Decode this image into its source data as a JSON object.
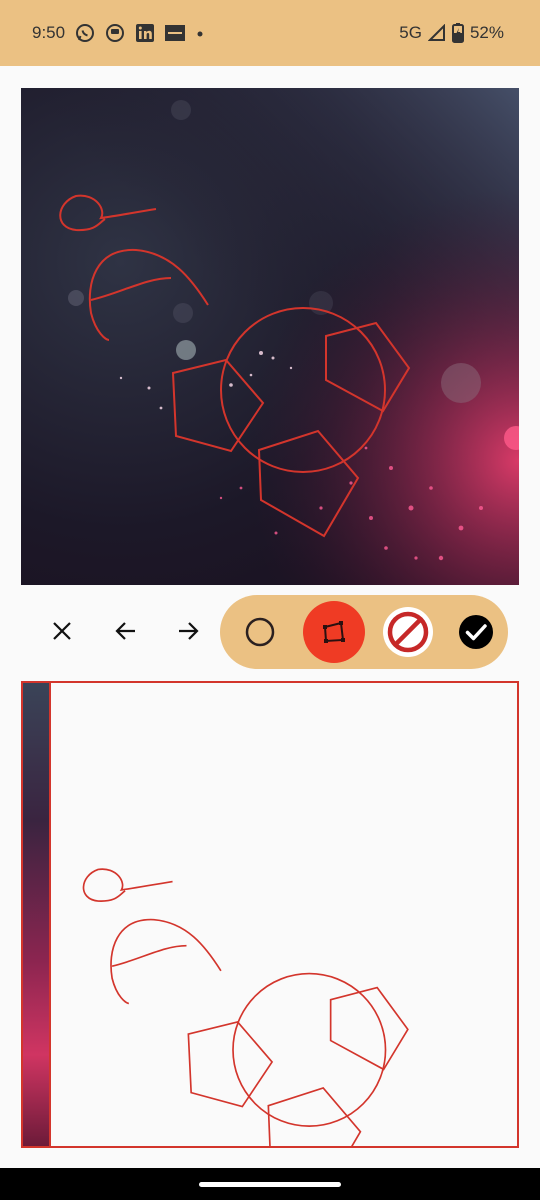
{
  "status_bar": {
    "time": "9:50",
    "network": "5G",
    "battery": "52%",
    "notification_icons": [
      "whatsapp-icon",
      "app-icon",
      "linkedin-icon",
      "news-app-icon",
      "more-dot-icon"
    ],
    "background": "#ebc183"
  },
  "editor": {
    "photo_description_colors": {
      "dark": "#1a1527",
      "accent": "#e03a6a"
    },
    "stroke_color": "#d3352c"
  },
  "toolbar": {
    "close_icon": "close-icon",
    "undo_icon": "arrow-left-icon",
    "redo_icon": "arrow-right-icon",
    "tools": [
      {
        "name": "circle-tool",
        "icon": "circle-outline-icon",
        "active": false
      },
      {
        "name": "polygon-tool",
        "icon": "polygon-crop-icon",
        "active": true
      },
      {
        "name": "erase-tool",
        "icon": "prohibited-icon",
        "active": false
      },
      {
        "name": "confirm-tool",
        "icon": "check-circle-icon",
        "active": false
      }
    ],
    "pill_color": "#ebc183",
    "active_color": "#ef3b24"
  }
}
